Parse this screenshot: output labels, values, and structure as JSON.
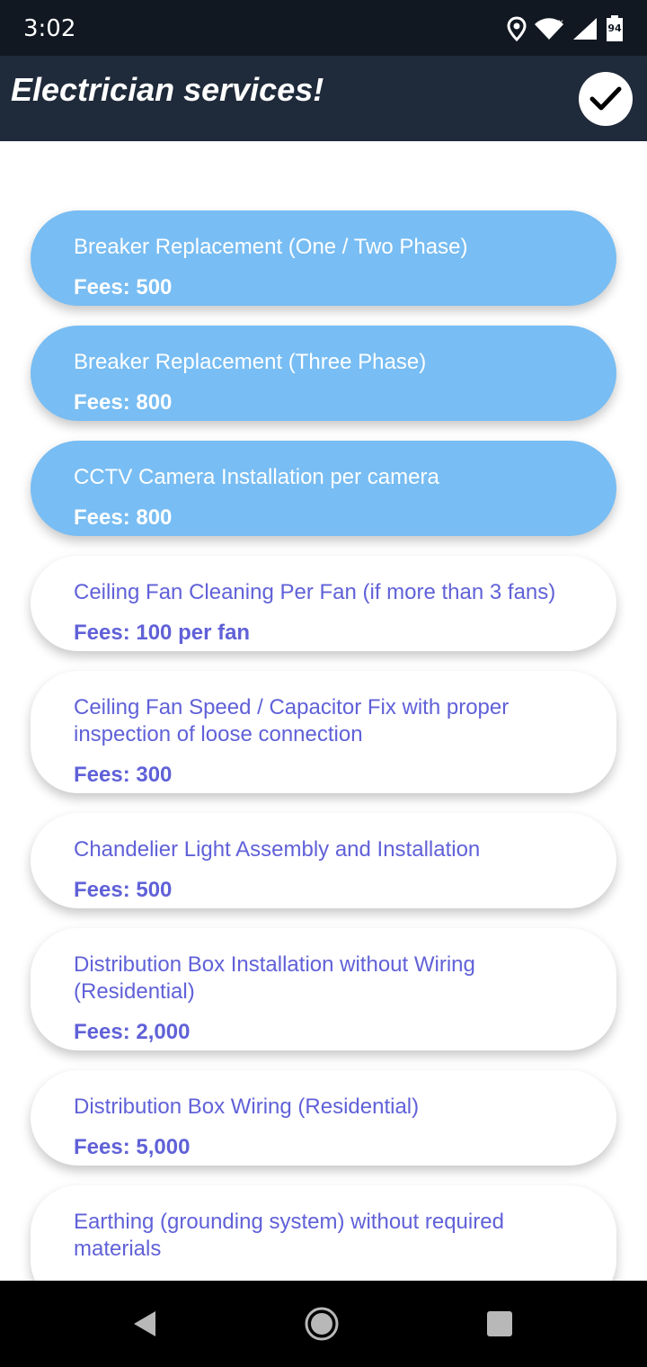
{
  "status_bar": {
    "time": "3:02",
    "battery_level": "94",
    "icons": [
      "location-icon",
      "wifi-icon",
      "signal-icon",
      "battery-icon"
    ]
  },
  "app_bar": {
    "title": "Electrician services!",
    "confirm_icon": "checkmark-icon"
  },
  "colors": {
    "status_bar_bg": "#111821",
    "app_bar_bg": "#1f2a3a",
    "selected_card_bg": "#78bdf3",
    "unselected_card_text": "#6061d8"
  },
  "services": [
    {
      "name": "Breaker Replacement (One / Two Phase)",
      "fee": "Fees: 500",
      "selected": true
    },
    {
      "name": "Breaker Replacement (Three Phase)",
      "fee": "Fees: 800",
      "selected": true
    },
    {
      "name": "CCTV Camera Installation per camera",
      "fee": "Fees: 800",
      "selected": true
    },
    {
      "name": "Ceiling Fan Cleaning Per Fan (if more than 3 fans)",
      "fee": "Fees: 100 per fan",
      "selected": false
    },
    {
      "name": "Ceiling Fan Speed / Capacitor Fix with proper inspection of loose connection",
      "fee": "Fees: 300",
      "selected": false
    },
    {
      "name": "Chandelier Light Assembly and Installation",
      "fee": "Fees: 500",
      "selected": false
    },
    {
      "name": "Distribution Box Installation without Wiring (Residential)",
      "fee": "Fees: 2,000",
      "selected": false
    },
    {
      "name": "Distribution Box Wiring (Residential)",
      "fee": "Fees: 5,000",
      "selected": false
    },
    {
      "name": "Earthing (grounding system) without required materials",
      "fee": "",
      "selected": false
    }
  ],
  "nav_bar": {
    "icons": [
      "back-icon",
      "home-icon",
      "recents-icon"
    ]
  }
}
